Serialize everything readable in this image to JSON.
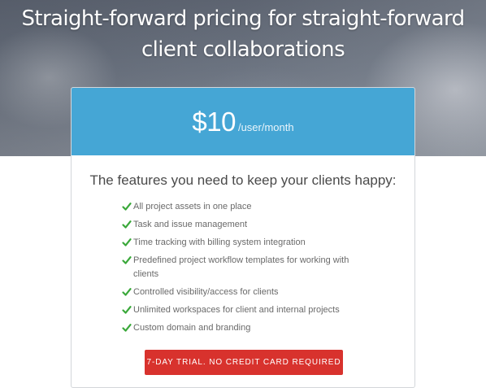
{
  "hero": {
    "headline_line1": "Straight-forward pricing for straight-forward",
    "headline_line2": "client collaborations"
  },
  "pricing": {
    "amount": "$10",
    "unit": "/user/month",
    "features_heading": "The features you need to keep your clients happy:",
    "features": [
      "All project assets in one place",
      "Task and issue management",
      "Time tracking with billing system integration",
      "Predefined project workflow templates for working with clients",
      "Controlled visibility/access for clients",
      "Unlimited workspaces for client and internal projects",
      "Custom domain and branding"
    ],
    "cta_label": "7-Day trial. No credit card required"
  },
  "colors": {
    "price_band": "#45a6d5",
    "check": "#3aa83a",
    "cta": "#d8322d"
  },
  "icons": {
    "feature_bullet": "check-icon"
  }
}
